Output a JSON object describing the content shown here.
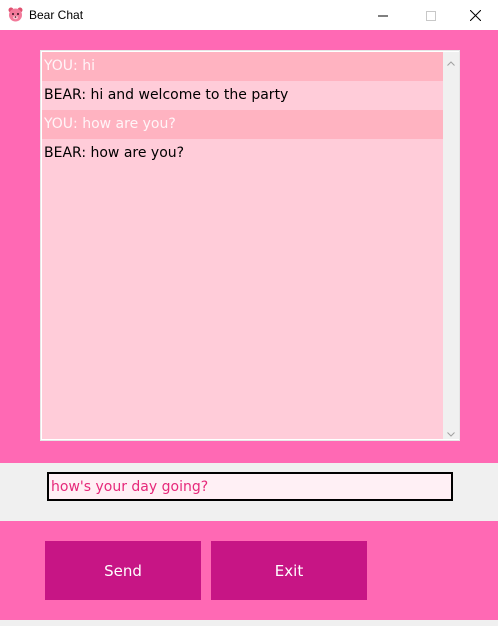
{
  "window": {
    "title": "Bear Chat",
    "icon": "bear-face-icon"
  },
  "window_controls": {
    "minimize": "minimize-icon",
    "maximize": "maximize-icon",
    "close": "close-icon"
  },
  "chat": {
    "messages": [
      {
        "sender": "YOU",
        "text": "YOU: hi"
      },
      {
        "sender": "BEAR",
        "text": "BEAR: hi and welcome to the party"
      },
      {
        "sender": "YOU",
        "text": "YOU: how are you?"
      },
      {
        "sender": "BEAR",
        "text": "BEAR: how are you?"
      }
    ]
  },
  "input": {
    "value": "how's your day going?"
  },
  "buttons": {
    "send_label": "Send",
    "exit_label": "Exit"
  },
  "colors": {
    "background_pink": "#ff69b4",
    "button": "#c71585",
    "chat_background": "#ffccd9",
    "you_row": "#ffb3c1",
    "input_text": "#e6287a"
  }
}
